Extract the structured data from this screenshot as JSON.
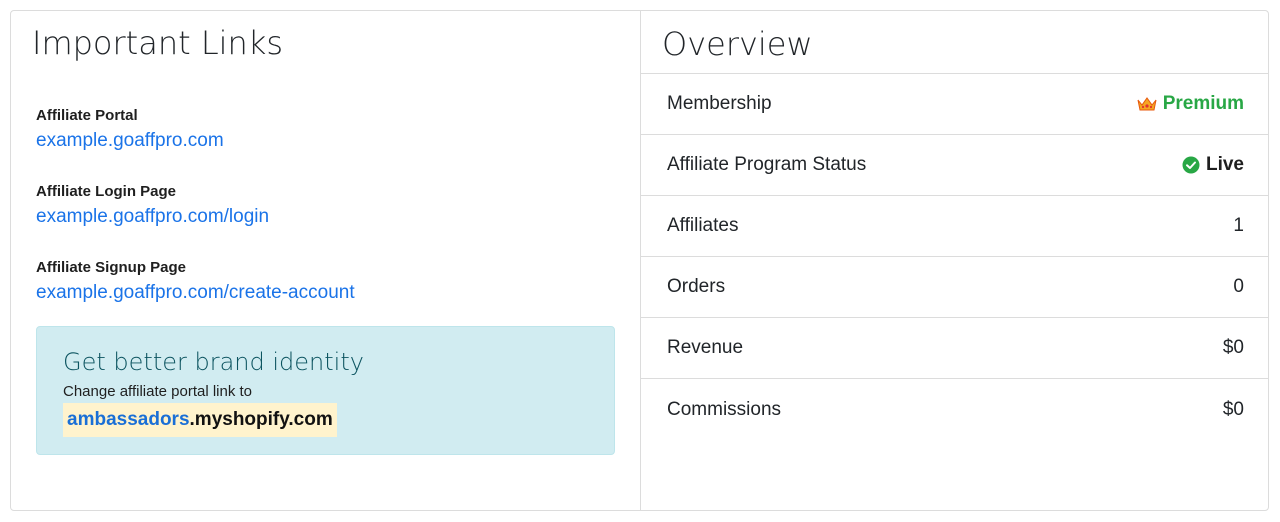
{
  "links_panel": {
    "title": "Important Links",
    "items": [
      {
        "label": "Affiliate Portal",
        "url": "example.goaffpro.com"
      },
      {
        "label": "Affiliate Login Page",
        "url": "example.goaffpro.com/login"
      },
      {
        "label": "Affiliate Signup Page",
        "url": "example.goaffpro.com/create-account"
      }
    ],
    "promo": {
      "title": "Get better brand identity",
      "text": "Change affiliate portal link to",
      "link_subdomain": "ambassadors",
      "link_domain": ".myshopify.com"
    }
  },
  "overview": {
    "title": "Overview",
    "rows": [
      {
        "label": "Membership",
        "value": "Premium"
      },
      {
        "label": "Affiliate Program Status",
        "value": "Live"
      },
      {
        "label": "Affiliates",
        "value": "1"
      },
      {
        "label": "Orders",
        "value": "0"
      },
      {
        "label": "Revenue",
        "value": "$0"
      },
      {
        "label": "Commissions",
        "value": "$0"
      }
    ],
    "membership_icon": "crown-icon",
    "status_icon": "check-circle-icon",
    "colors": {
      "premium": "#28a745",
      "live_icon": "#28a745",
      "link": "#1a73e8"
    }
  }
}
